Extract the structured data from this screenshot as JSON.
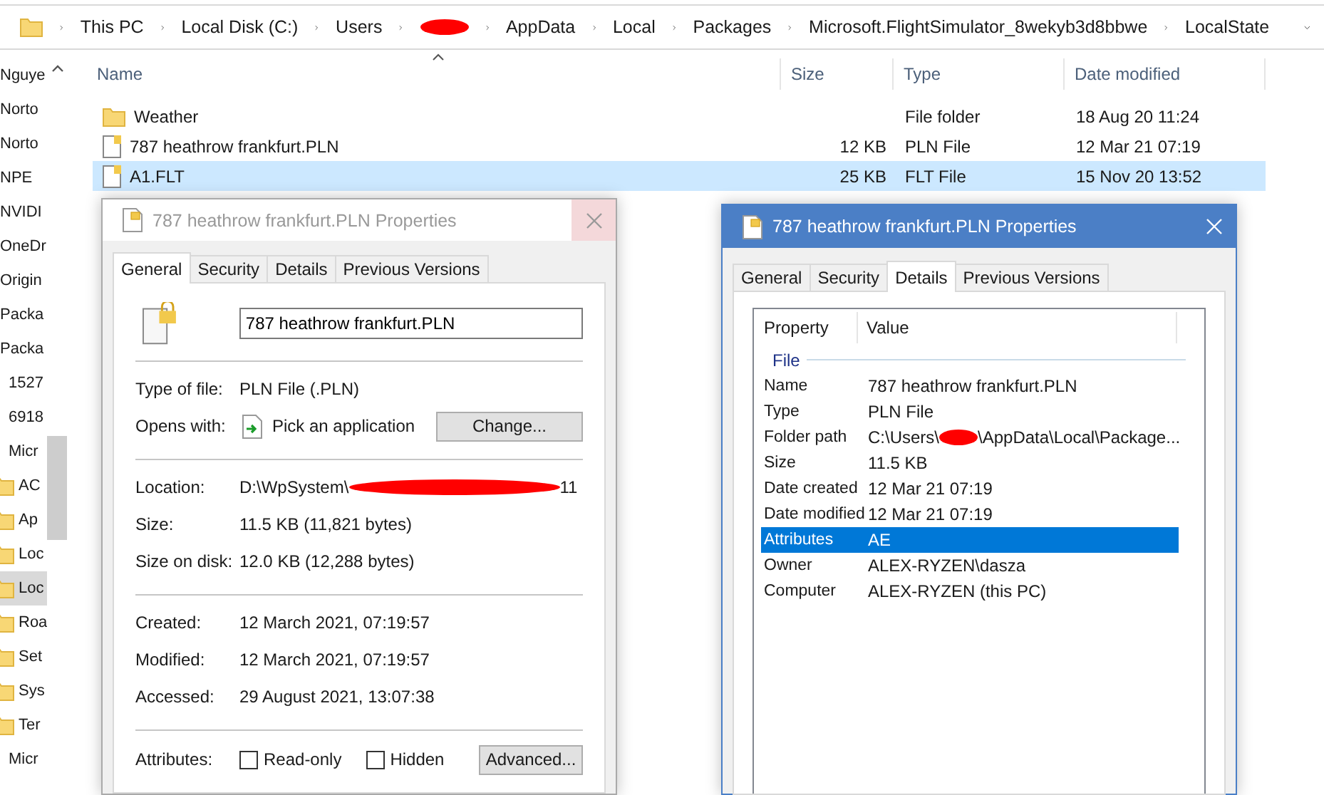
{
  "address_bar": {
    "crumbs": [
      {
        "kind": "text",
        "label": "This PC"
      },
      {
        "kind": "text",
        "label": "Local Disk (C:)"
      },
      {
        "kind": "text",
        "label": "Users"
      },
      {
        "kind": "redacted"
      },
      {
        "kind": "text",
        "label": "AppData"
      },
      {
        "kind": "text",
        "label": "Local"
      },
      {
        "kind": "text",
        "label": "Packages"
      },
      {
        "kind": "text",
        "label": "Microsoft.FlightSimulator_8wekyb3d8bbwe"
      },
      {
        "kind": "text",
        "label": "LocalState"
      }
    ]
  },
  "nav_pane": {
    "items": [
      {
        "label": "Nguye",
        "selected": false
      },
      {
        "label": "Norto",
        "selected": false
      },
      {
        "label": "Norto",
        "selected": false
      },
      {
        "label": "NPE",
        "selected": false
      },
      {
        "label": "NVIDI",
        "selected": false
      },
      {
        "label": "OneDr",
        "selected": false
      },
      {
        "label": "Origin",
        "selected": false
      },
      {
        "label": "Packa",
        "selected": false
      },
      {
        "label": "Packa",
        "selected": false,
        "children": [
          {
            "label": "1527",
            "selected": false
          },
          {
            "label": "6918",
            "selected": false
          },
          {
            "label": "Micr",
            "selected": false,
            "children": [
              {
                "label": "AC",
                "selected": false
              },
              {
                "label": "Ap",
                "selected": false
              },
              {
                "label": "Loc",
                "selected": false
              },
              {
                "label": "Loc",
                "selected": true
              },
              {
                "label": "Roa",
                "selected": false
              },
              {
                "label": "Set",
                "selected": false
              },
              {
                "label": "Sys",
                "selected": false
              },
              {
                "label": "Ter",
                "selected": false
              }
            ]
          },
          {
            "label": "Micr",
            "selected": false
          }
        ]
      }
    ]
  },
  "file_list": {
    "columns": [
      {
        "label": "Name",
        "sorted": true
      },
      {
        "label": "Size",
        "sorted": false
      },
      {
        "label": "Type",
        "sorted": false
      },
      {
        "label": "Date modified",
        "sorted": false
      }
    ],
    "rows": [
      {
        "kind": "folder",
        "name": "Weather",
        "size": "",
        "type": "File folder",
        "date_modified": "18 Aug 20 11:24",
        "selected": false
      },
      {
        "kind": "file",
        "name": "787 heathrow frankfurt.PLN",
        "size": "12 KB",
        "type": "PLN File",
        "date_modified": "12 Mar 21 07:19",
        "selected": false
      },
      {
        "kind": "file",
        "name": "A1.FLT",
        "size": "25 KB",
        "type": "FLT File",
        "date_modified": "15 Nov 20 13:52",
        "selected": true
      }
    ]
  },
  "general_dialog": {
    "title": "787 heathrow frankfurt.PLN Properties",
    "active": false,
    "close_hovered": true,
    "tabs": [
      {
        "label": "General",
        "selected": true
      },
      {
        "label": "Security",
        "selected": false
      },
      {
        "label": "Details",
        "selected": false
      },
      {
        "label": "Previous Versions",
        "selected": false
      }
    ],
    "file_name": "787 heathrow frankfurt.PLN",
    "sections": [
      [
        {
          "kind": "text",
          "label": "Type of file:",
          "value": "PLN File (.PLN)"
        },
        {
          "kind": "opens_with",
          "label": "Opens with:",
          "value": "Pick an application",
          "button": "Change..."
        }
      ],
      [
        {
          "kind": "redacted",
          "label": "Location:",
          "value_start": "D:\\WpSystem\\",
          "value_end": "11"
        },
        {
          "kind": "text",
          "label": "Size:",
          "value": "11.5 KB (11,821 bytes)"
        },
        {
          "kind": "text",
          "label": "Size on disk:",
          "value": "12.0 KB (12,288 bytes)"
        }
      ],
      [
        {
          "kind": "text",
          "label": "Created:",
          "value": "12 March 2021, 07:19:57"
        },
        {
          "kind": "text",
          "label": "Modified:",
          "value": "12 March 2021, 07:19:57"
        },
        {
          "kind": "text",
          "label": "Accessed:",
          "value": "29 August 2021, 13:07:38"
        }
      ]
    ],
    "attributes": {
      "label": "Attributes:",
      "checkboxes": [
        {
          "label": "Read-only",
          "checked": false
        },
        {
          "label": "Hidden",
          "checked": false
        }
      ],
      "button": "Advanced..."
    }
  },
  "details_dialog": {
    "title": "787 heathrow frankfurt.PLN Properties",
    "active": true,
    "close_hovered": false,
    "tabs": [
      {
        "label": "General",
        "selected": false
      },
      {
        "label": "Security",
        "selected": false
      },
      {
        "label": "Details",
        "selected": true
      },
      {
        "label": "Previous Versions",
        "selected": false
      }
    ],
    "columns": [
      "Property",
      "Value"
    ],
    "group": "File",
    "rows": [
      {
        "kind": "text",
        "property": "Name",
        "value": "787 heathrow frankfurt.PLN",
        "selected": false
      },
      {
        "kind": "text",
        "property": "Type",
        "value": "PLN File",
        "selected": false
      },
      {
        "kind": "redacted",
        "property": "Folder path",
        "value_start": "C:\\Users\\",
        "value_end": "\\AppData\\Local\\Package...",
        "selected": false
      },
      {
        "kind": "text",
        "property": "Size",
        "value": "11.5 KB",
        "selected": false
      },
      {
        "kind": "text",
        "property": "Date created",
        "value": "12 Mar 21 07:19",
        "selected": false
      },
      {
        "kind": "text",
        "property": "Date modified",
        "value": "12 Mar 21 07:19",
        "selected": false
      },
      {
        "kind": "text",
        "property": "Attributes",
        "value": "AE",
        "selected": true
      },
      {
        "kind": "text",
        "property": "Owner",
        "value": "ALEX-RYZEN\\dasza",
        "selected": false
      },
      {
        "kind": "text",
        "property": "Computer",
        "value": "ALEX-RYZEN (this PC)",
        "selected": false
      }
    ]
  }
}
